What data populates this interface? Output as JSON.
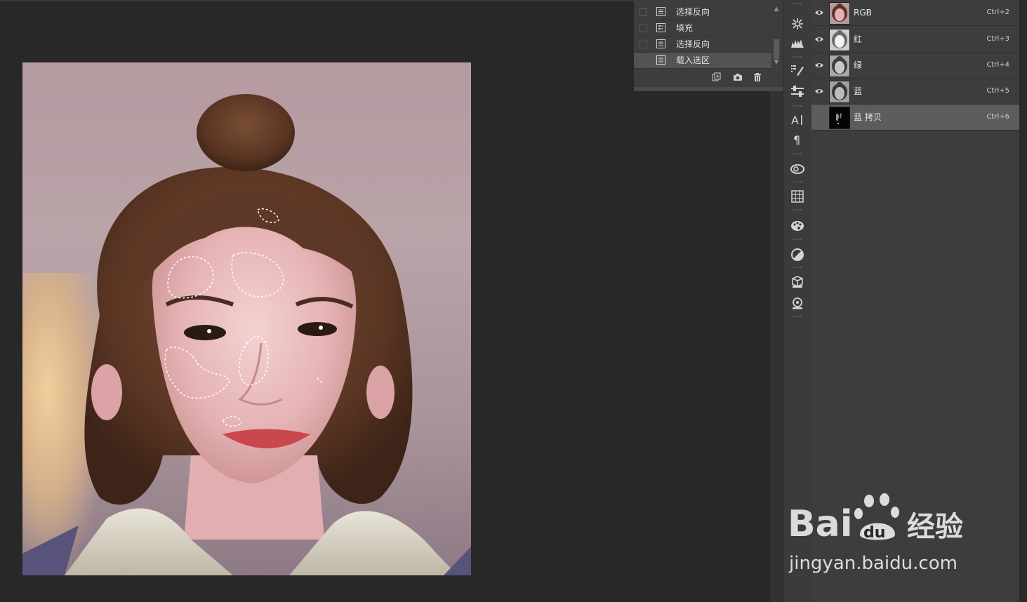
{
  "history": {
    "items": [
      {
        "label": "选择反向",
        "selected": false
      },
      {
        "label": "填充",
        "selected": false
      },
      {
        "label": "选择反向",
        "selected": false
      },
      {
        "label": "载入选区",
        "selected": true
      }
    ],
    "footer_icons": [
      "new-document-from-state-icon",
      "snapshot-camera-icon",
      "trash-icon"
    ]
  },
  "tools": [
    "asterisk-icon",
    "histogram-icon",
    "brush-presets-icon",
    "adjustment-sliders-icon",
    "character-type-icon",
    "paragraph-icon",
    "creative-cloud-icon",
    "grid-table-icon",
    "swatches-palette-icon",
    "adjustments-circle-icon",
    "3d-cube-icon",
    "tool-presets-icon"
  ],
  "channels": {
    "items": [
      {
        "name": "RGB",
        "shortcut": "Ctrl+2",
        "visible": true,
        "thumb": "color",
        "selected": false
      },
      {
        "name": "红",
        "shortcut": "Ctrl+3",
        "visible": true,
        "thumb": "gray-light",
        "selected": false
      },
      {
        "name": "绿",
        "shortcut": "Ctrl+4",
        "visible": true,
        "thumb": "gray",
        "selected": false
      },
      {
        "name": "蓝",
        "shortcut": "Ctrl+5",
        "visible": true,
        "thumb": "gray",
        "selected": false
      },
      {
        "name": "蓝 拷贝",
        "shortcut": "Ctrl+6",
        "visible": false,
        "thumb": "black",
        "selected": true
      }
    ]
  },
  "watermark": {
    "logo_text": "Bai du 经验",
    "url": "jingyan.baidu.com"
  }
}
